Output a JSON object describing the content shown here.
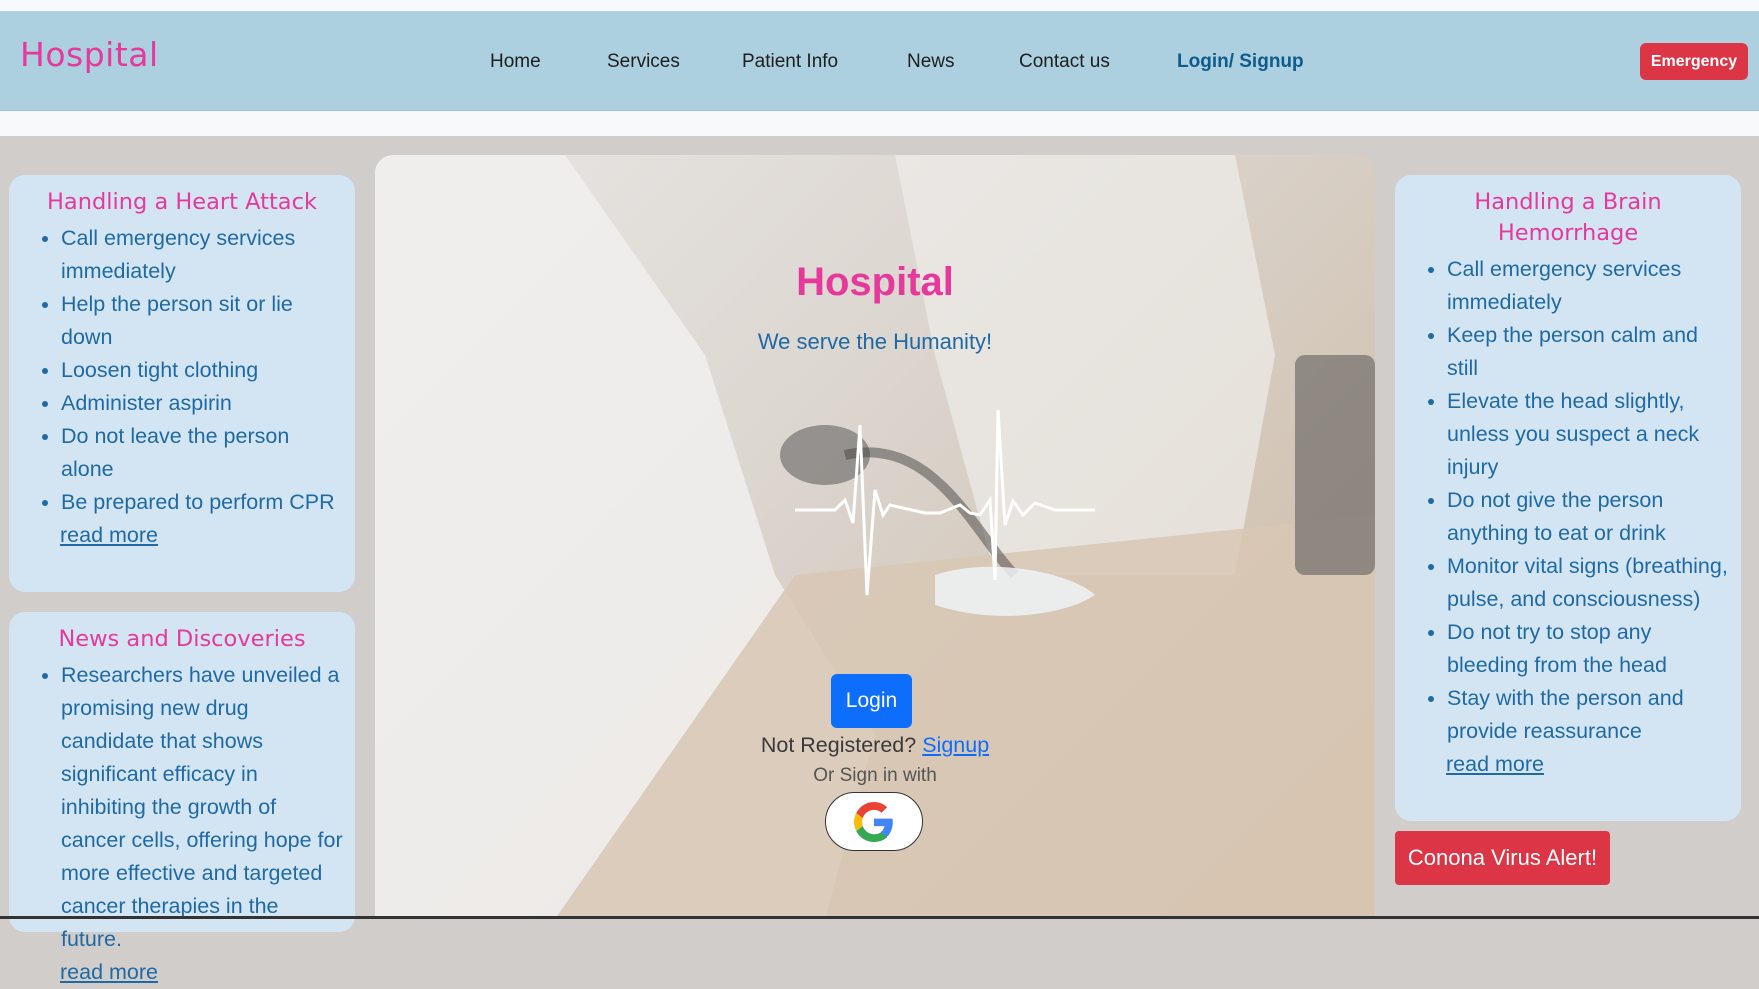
{
  "brand": "Hospital",
  "nav": {
    "home": "Home",
    "services": "Services",
    "patient_info": "Patient Info",
    "news": "News",
    "contact": "Contact us",
    "login_signup": "Login/ Signup",
    "emergency": "Emergency"
  },
  "heart_card": {
    "title": "Handling a Heart Attack",
    "items": [
      "Call emergency services immediately",
      "Help the person sit or lie down",
      "Loosen tight clothing",
      "Administer aspirin",
      "Do not leave the person alone",
      "Be prepared to perform CPR"
    ],
    "read_more": "read more"
  },
  "news_card": {
    "title": "News and Discoveries",
    "items": [
      "Researchers have unveiled a promising new drug candidate that shows significant efficacy in inhibiting the growth of cancer cells, offering hope for more effective and targeted cancer therapies in the future."
    ],
    "read_more": "read more"
  },
  "brain_card": {
    "title": "Handling a Brain Hemorrhage",
    "items": [
      "Call emergency services immediately",
      "Keep the person calm and still",
      "Elevate the head slightly, unless you suspect a neck injury",
      "Do not give the person anything to eat or drink",
      "Monitor vital signs (breathing, pulse, and consciousness)",
      "Do not try to stop any bleeding from the head",
      "Stay with the person and provide reassurance"
    ],
    "read_more": "read more"
  },
  "hero": {
    "title": "Hospital",
    "subtitle": "We serve the Humanity!",
    "login_button": "Login",
    "not_registered": "Not Registered?",
    "signup_link": "Signup",
    "or_sign_in": "Or Sign in with",
    "google_icon": "google-icon"
  },
  "alert_button": "Conona Virus Alert!",
  "colors": {
    "navbar": "#acd0e0",
    "brand_pink": "#e5399b",
    "card_bg": "#d3e5f3",
    "text_blue": "#1f6aa5",
    "emergency_red": "#dc3545",
    "login_blue": "#0d6efd"
  }
}
